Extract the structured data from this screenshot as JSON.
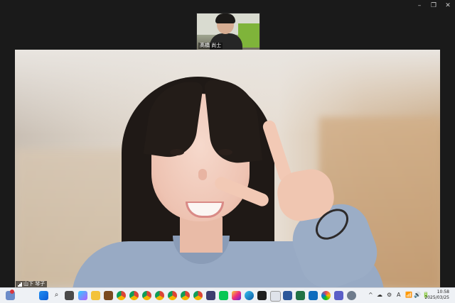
{
  "window_controls": {
    "minimize": "–",
    "maximize": "❐",
    "close": "✕"
  },
  "thumbnail": {
    "name": "髙橋 尚士"
  },
  "main_video": {
    "name": "山下 琴子"
  },
  "taskbar": {
    "icons": [
      "notification-icon",
      "start-icon",
      "search-icon",
      "task-view-icon",
      "copilot-icon",
      "file-explorer-icon",
      "puzzle-icon",
      "chrome-icon",
      "chrome-icon",
      "chrome-icon",
      "chrome-icon",
      "chrome-icon",
      "chrome-icon",
      "chrome-icon",
      "screen-icon",
      "line-icon",
      "instagram-icon",
      "edge-icon",
      "chatgpt-icon",
      "store-icon",
      "word-icon",
      "excel-icon",
      "outlook-icon",
      "paint-icon",
      "teams-icon",
      "settings-icon"
    ],
    "tray_labels": [
      "^",
      "☁",
      "⚙",
      "A",
      "📶",
      "🔊",
      "🔋"
    ],
    "time": "10:58",
    "date": "2025/03/25"
  }
}
